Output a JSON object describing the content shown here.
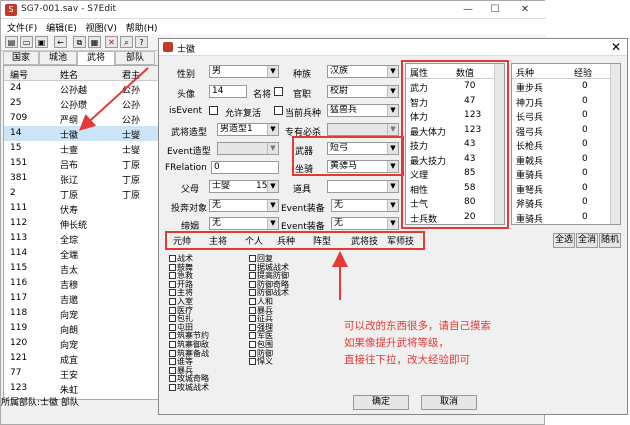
{
  "main": {
    "title": "SG7-001.sav - S7Edit",
    "menu": [
      "文件(F)",
      "编辑(E)",
      "视图(V)",
      "帮助(H)"
    ],
    "toolbar_icons": [
      "open-icon",
      "folder-icon",
      "save-icon",
      "back-icon",
      "copy-icon",
      "paste-icon",
      "close-icon",
      "search-icon",
      "help-icon"
    ],
    "tabs": [
      "国家",
      "城池",
      "武将",
      "部队"
    ],
    "columns": [
      "编号",
      "姓名",
      "君主"
    ],
    "rows": [
      [
        "24",
        "公孙越",
        "公孙"
      ],
      [
        "25",
        "公孙瓒",
        "公孙"
      ],
      [
        "709",
        "严纲",
        "公孙"
      ],
      [
        "14",
        "士徽",
        "士燮"
      ],
      [
        "15",
        "士壹",
        "士燮"
      ],
      [
        "151",
        "吕布",
        "丁原"
      ],
      [
        "381",
        "张辽",
        "丁原"
      ],
      [
        "2",
        "丁原",
        "丁原"
      ],
      [
        "111",
        "伏寿",
        ""
      ],
      [
        "112",
        "伸长统",
        ""
      ],
      [
        "113",
        "全琮",
        ""
      ],
      [
        "114",
        "全端",
        ""
      ],
      [
        "115",
        "吉太",
        ""
      ],
      [
        "116",
        "吉穆",
        ""
      ],
      [
        "117",
        "吉邈",
        ""
      ],
      [
        "118",
        "向宠",
        ""
      ],
      [
        "119",
        "向朗",
        ""
      ],
      [
        "120",
        "向宠",
        ""
      ],
      [
        "121",
        "成宜",
        ""
      ],
      [
        "77",
        "王安",
        ""
      ],
      [
        "123",
        "朱虹",
        ""
      ],
      [
        "124",
        "朱灵",
        ""
      ]
    ],
    "status": "所属部队:士徽 部队"
  },
  "dialog": {
    "title": "士徽",
    "form": {
      "gender_label": "性别",
      "gender": "男",
      "avatar_label": "头像",
      "avatar": "14",
      "famous_label": "名将",
      "isevent_label": "isEvent",
      "allow_revive_label": "允许复活",
      "face_label": "武将造型",
      "face": "男造型1",
      "event_face_label": "Event造型",
      "frelation_label": "FRelation",
      "frelation": "0",
      "father_label": "父母",
      "father": "士燮",
      "father_num": "15",
      "surrender_label": "投奔对象",
      "surrender": "无",
      "spouse_label": "缔姻",
      "spouse": "无",
      "race_label": "种族",
      "race": "汉族",
      "office_label": "官职",
      "office": "校尉",
      "cur_troop_label": "当前兵种",
      "cur_troop": "猛兽兵",
      "special_label": "专有必杀",
      "weapon_label": "武器",
      "weapon": "短弓",
      "mount_label": "坐骑",
      "mount": "黄骠马",
      "item_label": "道具",
      "event_eq1_label": "Event装备",
      "event_eq1": "无",
      "event_eq2_label": "Event装备",
      "event_eq2": "无"
    },
    "attr_headers": [
      "属性",
      "数值"
    ],
    "attrs": [
      [
        "武力",
        "70"
      ],
      [
        "智力",
        "47"
      ],
      [
        "体力",
        "123"
      ],
      [
        "最大体力",
        "123"
      ],
      [
        "技力",
        "43"
      ],
      [
        "最大技力",
        "43"
      ],
      [
        "义理",
        "85"
      ],
      [
        "相性",
        "58"
      ],
      [
        "士气",
        "80"
      ],
      [
        "士兵数",
        "20"
      ]
    ],
    "troop_headers": [
      "兵种",
      "经验"
    ],
    "troops": [
      [
        "重步兵",
        "0"
      ],
      [
        "神刀兵",
        "0"
      ],
      [
        "长弓兵",
        "0"
      ],
      [
        "强弓兵",
        "0"
      ],
      [
        "长枪兵",
        "0"
      ],
      [
        "重戟兵",
        "0"
      ],
      [
        "重骑兵",
        "0"
      ],
      [
        "重弩兵",
        "0"
      ],
      [
        "斧骑兵",
        "0"
      ],
      [
        "重骑兵",
        "0"
      ]
    ],
    "tabs": [
      "元帅",
      "主将",
      "个人",
      "兵种",
      "阵型",
      "武将技",
      "军师技"
    ],
    "right_buttons": [
      "全选",
      "全消",
      "随机"
    ],
    "skills_col1": [
      "战术",
      "鼓舞",
      "急救",
      "开路",
      "主将",
      "入室",
      "医疗",
      "包扎",
      "屯田",
      "筑寨节约",
      "筑寨御敌",
      "筑寨备战",
      "谁等",
      "暴兵",
      "攻城奇略",
      "攻城战术"
    ],
    "skills_col2": [
      "回复",
      "据城战术",
      "提高防御",
      "防御奇略",
      "防御战术",
      "人和",
      "暴兵",
      "征兵",
      "强理",
      "军医",
      "包围",
      "防御",
      "悍义"
    ],
    "ok": "确定",
    "cancel": "取消"
  },
  "annotation": {
    "line1": "可以改的东西很多，请自己摸索",
    "line2": "如果像提升武将等级，",
    "line3": "直接往下拉，改大经验即可"
  },
  "colors": {
    "accent_red": "#e53935"
  }
}
